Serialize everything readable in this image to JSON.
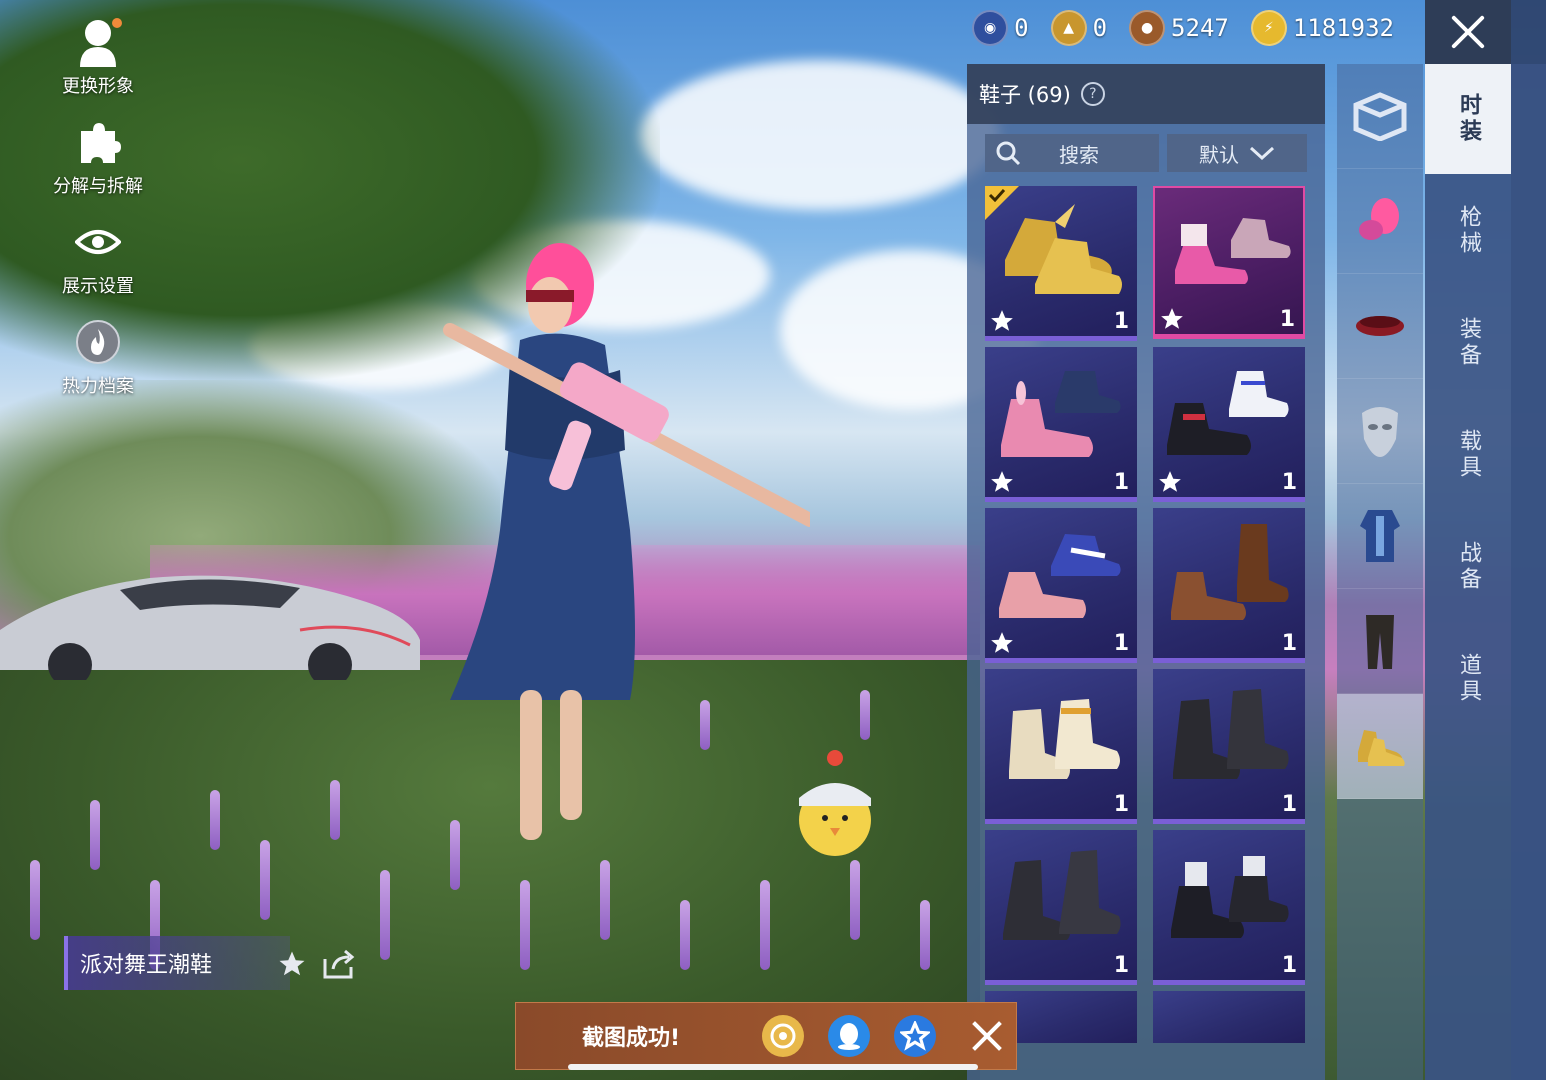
{
  "left_menu": [
    {
      "label": "更换形象",
      "icon": "avatar-icon"
    },
    {
      "label": "分解与拆解",
      "icon": "puzzle-icon"
    },
    {
      "label": "展示设置",
      "icon": "eye-icon"
    },
    {
      "label": "热力档案",
      "icon": "flame-icon"
    }
  ],
  "currency": [
    {
      "value": "0",
      "icon": "blue-coin-icon",
      "color": "#2f4f9e"
    },
    {
      "value": "0",
      "icon": "gold-emblem-icon",
      "color": "#c8962e"
    },
    {
      "value": "5247",
      "icon": "bronze-coin-icon",
      "color": "#9a5a2a"
    },
    {
      "value": "1181932",
      "icon": "lightning-coin-icon",
      "color": "#e6b92e"
    }
  ],
  "panel": {
    "title": "鞋子 (69)",
    "help_label": "?",
    "search_placeholder": "搜索",
    "sort_label": "默认"
  },
  "items": [
    {
      "count": "1",
      "star": true,
      "equipped": true,
      "rarity": "purple",
      "color": "#d4a93a",
      "icon": "gold-winged-sneakers-icon"
    },
    {
      "count": "1",
      "star": true,
      "equipped": false,
      "rarity": "pink",
      "color": "#e85aa8",
      "icon": "pink-mary-jane-shoes-icon"
    },
    {
      "count": "1",
      "star": true,
      "equipped": false,
      "rarity": "purple",
      "color": "#e98ab0",
      "icon": "pink-bunny-sneakers-icon"
    },
    {
      "count": "1",
      "star": true,
      "equipped": false,
      "rarity": "purple",
      "color": "#d03040",
      "icon": "red-black-sneakers-icon"
    },
    {
      "count": "1",
      "star": true,
      "equipped": false,
      "rarity": "purple",
      "color": "#e8a0a8",
      "icon": "blue-pink-sneakers-icon"
    },
    {
      "count": "1",
      "star": false,
      "equipped": false,
      "rarity": "purple",
      "color": "#7a4a2a",
      "icon": "brown-boots-icon"
    },
    {
      "count": "1",
      "star": false,
      "equipped": false,
      "rarity": "purple",
      "color": "#e8dcc0",
      "icon": "cream-high-tops-icon"
    },
    {
      "count": "1",
      "star": false,
      "equipped": false,
      "rarity": "purple",
      "color": "#2a2a30",
      "icon": "black-combat-boots-icon"
    },
    {
      "count": "1",
      "star": false,
      "equipped": false,
      "rarity": "purple",
      "color": "#2e2e36",
      "icon": "black-tall-boots-icon"
    },
    {
      "count": "1",
      "star": false,
      "equipped": false,
      "rarity": "purple",
      "color": "#1e1e26",
      "icon": "black-dress-shoes-icon"
    }
  ],
  "category_tabs": [
    {
      "label": "时装",
      "active": true
    },
    {
      "label": "枪械",
      "active": false
    },
    {
      "label": "装备",
      "active": false
    },
    {
      "label": "载具",
      "active": false
    },
    {
      "label": "战备",
      "active": false
    },
    {
      "label": "道具",
      "active": false
    }
  ],
  "sub_tabs": [
    {
      "icon": "suit-box-icon",
      "active": false
    },
    {
      "icon": "pink-hair-icon",
      "active": false
    },
    {
      "icon": "headband-icon",
      "active": false
    },
    {
      "icon": "mask-icon",
      "active": false
    },
    {
      "icon": "outfit-icon",
      "active": false
    },
    {
      "icon": "pants-icon",
      "active": false
    },
    {
      "icon": "shoes-icon",
      "active": true
    }
  ],
  "item_name": "派对舞王潮鞋",
  "toast": {
    "text": "截图成功!",
    "buttons": [
      {
        "icon": "wechat-moments-icon",
        "color": "#e8b84a"
      },
      {
        "icon": "qq-icon",
        "color": "#2a8ae8"
      },
      {
        "icon": "qzone-icon",
        "color": "#2a7ae0"
      }
    ]
  },
  "colors": {
    "accent_purple": "#7a5fd6",
    "accent_pink": "#e04aa3",
    "equipped_gold": "#f2c13a"
  }
}
